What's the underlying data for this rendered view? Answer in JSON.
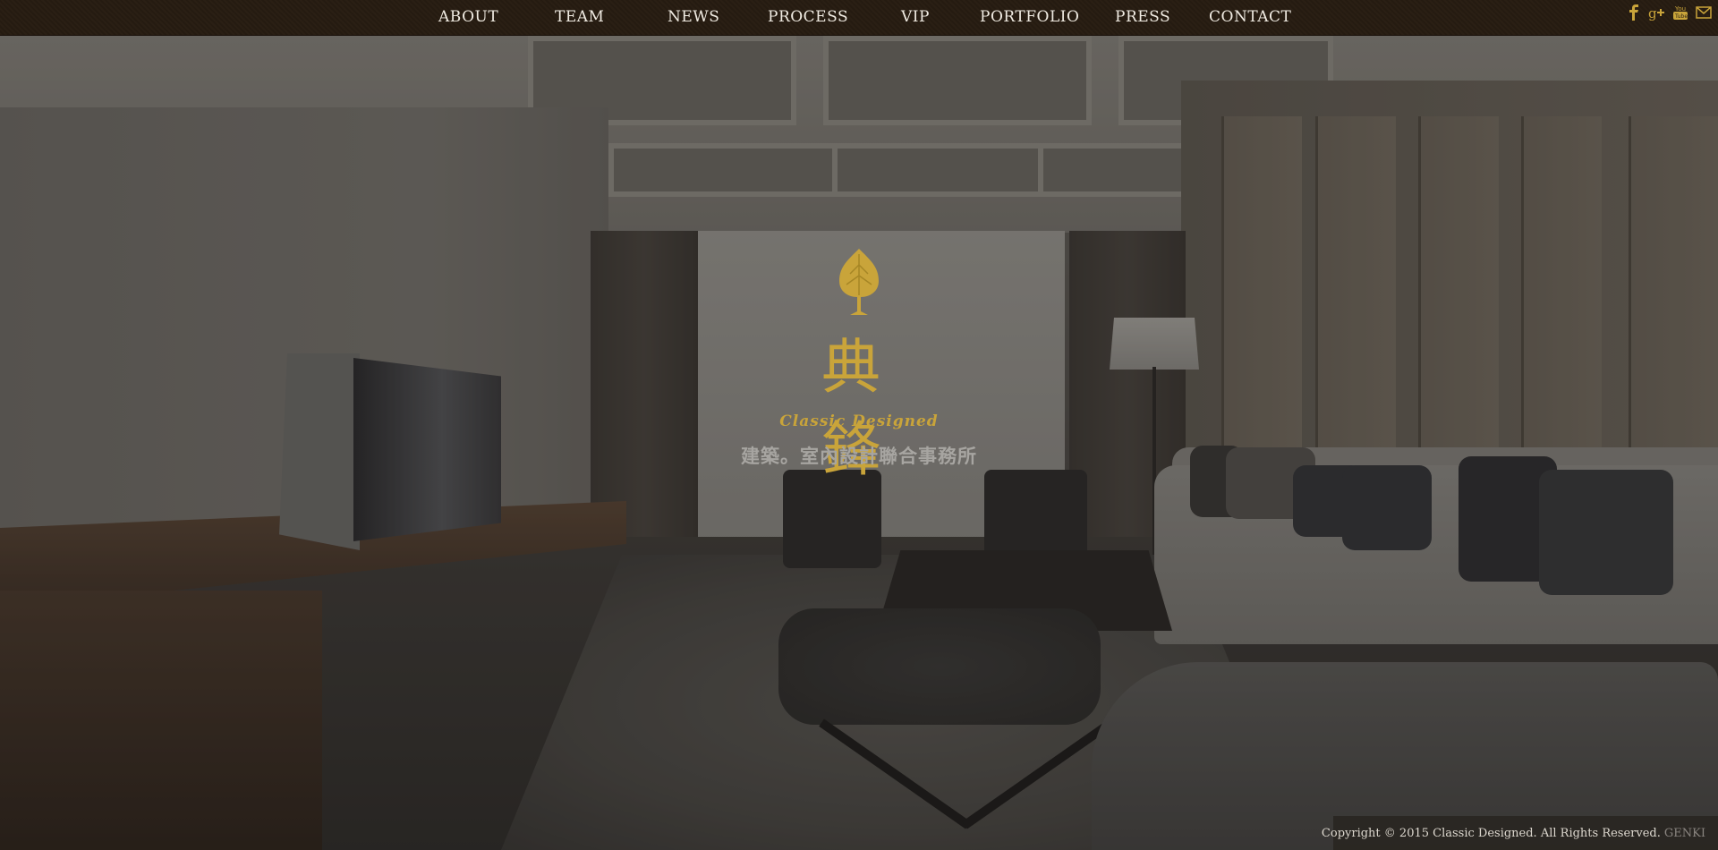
{
  "nav": {
    "items": [
      {
        "label": "ABOUT"
      },
      {
        "label": "TEAM"
      },
      {
        "label": "NEWS"
      },
      {
        "label": "PROCESS"
      },
      {
        "label": "VIP"
      },
      {
        "label": "PORTFOLIO"
      },
      {
        "label": "PRESS"
      },
      {
        "label": "CONTACT"
      }
    ]
  },
  "social": {
    "icons": [
      "facebook-icon",
      "google-plus-icon",
      "youtube-icon",
      "mail-icon"
    ],
    "color": "#c9a43a"
  },
  "logo": {
    "mark_icon": "bodhi-leaf-icon",
    "chinese_name": "典鋒",
    "english_name": "Classic Designed",
    "tagline": "建築。室內設計聯合事務所",
    "color": "#c9a43a"
  },
  "footer": {
    "copyright": "Copyright © 2015 Classic Designed. All Rights Reserved.",
    "credit_link": "GENKI"
  },
  "colors": {
    "nav_bg": "#2a1f14",
    "nav_text": "#f1ece3",
    "accent_gold": "#c9a43a",
    "tagline_gray": "#a7a5a1"
  }
}
